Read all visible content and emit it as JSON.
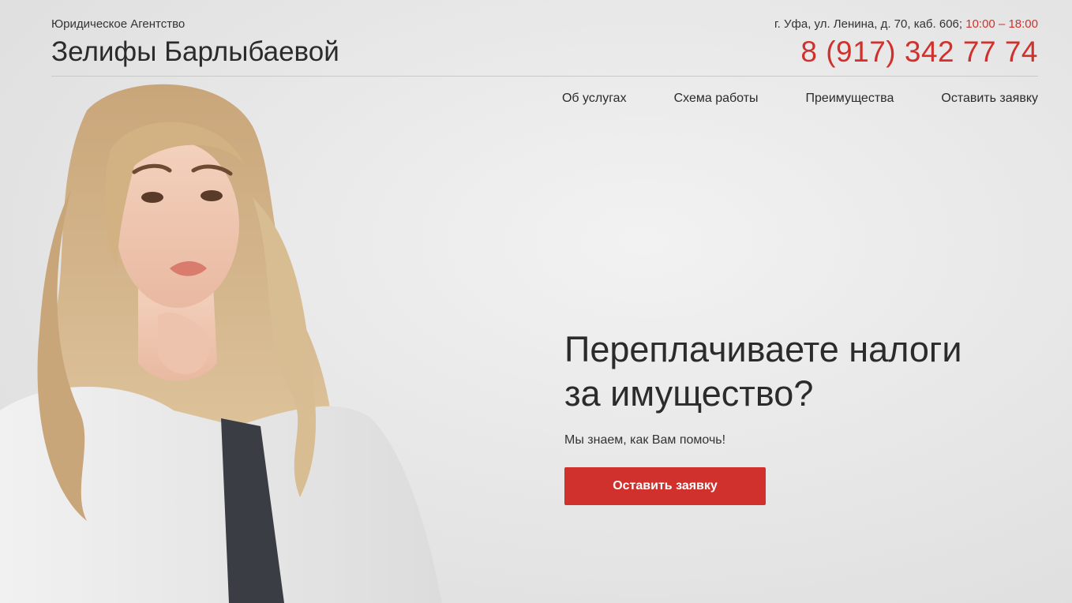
{
  "header": {
    "subtitle": "Юридическое Агентство",
    "name": "Зелифы Барлыбаевой",
    "address": "г. Уфа, ул. Ленина, д. 70, каб. 606;",
    "hours": "10:00 – 18:00",
    "phone": "8 (917) 342 77 74"
  },
  "nav": {
    "items": [
      {
        "label": "Об услугах"
      },
      {
        "label": "Схема работы"
      },
      {
        "label": "Преимущества"
      },
      {
        "label": "Оставить заявку"
      }
    ]
  },
  "hero": {
    "title_line1": "Переплачиваете налоги",
    "title_line2": "за имущество?",
    "subtitle": "Мы знаем, как Вам помочь!",
    "cta_label": "Оставить заявку"
  },
  "colors": {
    "accent": "#d0312d",
    "text": "#2b2b2b",
    "background": "#e8e8e8"
  }
}
